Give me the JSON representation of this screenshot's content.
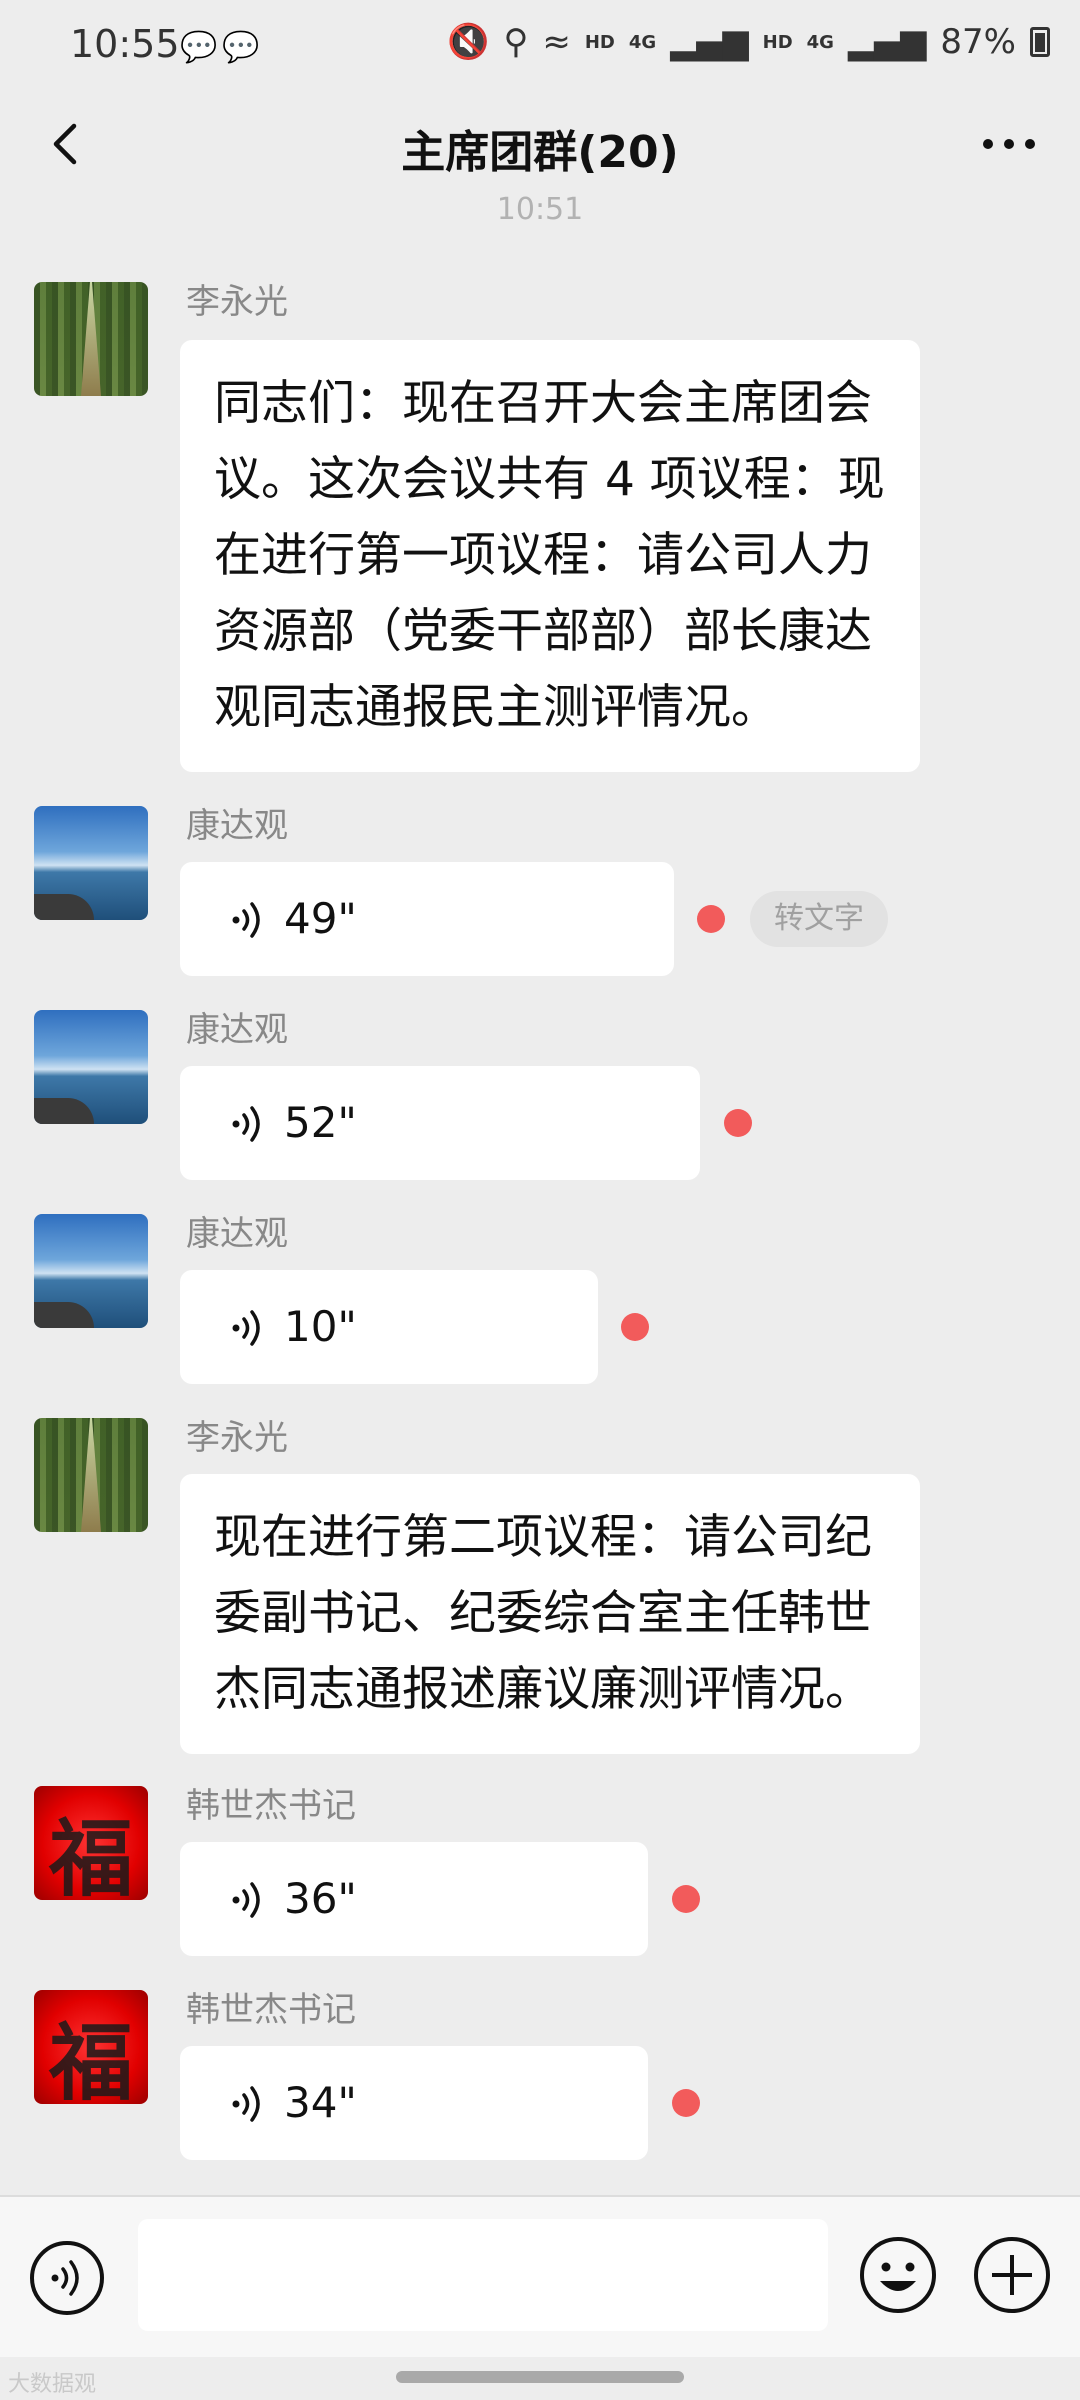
{
  "status_bar": {
    "time": "10:55",
    "hd1": "HD",
    "net1": "4G",
    "hd2": "HD",
    "net2": "4G",
    "battery": "87%"
  },
  "header": {
    "title": "主席团群(20)"
  },
  "timestamp": "10:51",
  "messages": [
    {
      "sender": "李永光",
      "text": "同志们：现在召开大会主席团会议。这次会议共有 4 项议程：现在进行第一项议程：请公司人力资源部（党委干部部）部长康达观同志通报民主测评情况。"
    },
    {
      "sender": "康达观",
      "duration": "49\"",
      "convert_label": "转文字"
    },
    {
      "sender": "康达观",
      "duration": "52\""
    },
    {
      "sender": "康达观",
      "duration": "10\""
    },
    {
      "sender": "李永光",
      "text": "现在进行第二项议程：请公司纪委副书记、纪委综合室主任韩世杰同志通报述廉议廉测评情况。"
    },
    {
      "sender": "韩世杰书记",
      "duration": "36\""
    },
    {
      "sender": "韩世杰书记",
      "duration": "34\""
    }
  ],
  "avatar_glyph": "福",
  "watermark": "大数据观",
  "colors": {
    "unread_dot": "#f25b5b",
    "background": "#ededed",
    "bubble": "#ffffff"
  }
}
